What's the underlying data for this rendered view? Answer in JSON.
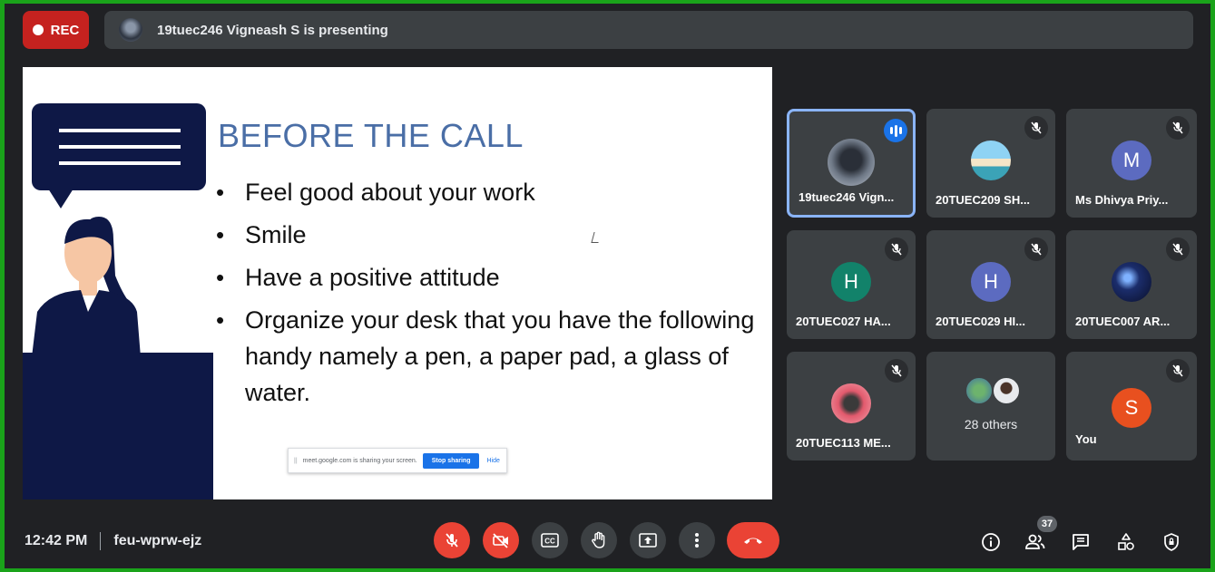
{
  "top_bar": {
    "rec_label": "REC",
    "presenting_text": "19tuec246 Vigneash S is presenting"
  },
  "slide": {
    "title": "BEFORE THE CALL",
    "bullets": [
      "Feel good about your work",
      "Smile",
      "Have a positive attitude",
      "Organize your desk that you have the following handy namely a pen, a paper pad, a glass of water."
    ],
    "share_bar": {
      "grip": "||",
      "message": "meet.google.com is sharing your screen.",
      "stop_label": "Stop sharing",
      "hide_label": "Hide"
    }
  },
  "participants": [
    {
      "name": "19tuec246 Vign...",
      "avatar_type": "photo",
      "speaking": true
    },
    {
      "name": "20TUEC209 SH...",
      "avatar_type": "photo",
      "muted": true
    },
    {
      "name": "Ms Dhivya Priy...",
      "avatar_letter": "M",
      "avatar_color": "#5c6bc0",
      "muted": true
    },
    {
      "name": "20TUEC027 HA...",
      "avatar_letter": "H",
      "avatar_color": "#12826a",
      "muted": true
    },
    {
      "name": "20TUEC029 HI...",
      "avatar_letter": "H",
      "avatar_color": "#5c6bc0",
      "muted": true
    },
    {
      "name": "20TUEC007 AR...",
      "avatar_type": "photo",
      "muted": true
    },
    {
      "name": "20TUEC113 ME...",
      "avatar_type": "photo",
      "muted": true
    },
    {
      "others_label": "28 others"
    },
    {
      "name": "You",
      "avatar_letter": "S",
      "avatar_color": "#e8501f",
      "muted": true
    }
  ],
  "bottom_bar": {
    "time": "12:42 PM",
    "meeting_code": "feu-wprw-ejz",
    "people_count": "37",
    "controls": [
      "mic-off-icon",
      "camera-off-icon",
      "captions-icon",
      "raise-hand-icon",
      "present-icon",
      "more-options-icon",
      "end-call-icon"
    ],
    "right_icons": [
      "info-icon",
      "people-icon",
      "chat-icon",
      "activities-icon",
      "host-controls-icon"
    ]
  },
  "colors": {
    "background": "#202124",
    "tile": "#3c4043",
    "rec": "#c5221f",
    "end_call": "#ea4335",
    "accent": "#8ab4f8",
    "frame": "#1aa31a"
  }
}
